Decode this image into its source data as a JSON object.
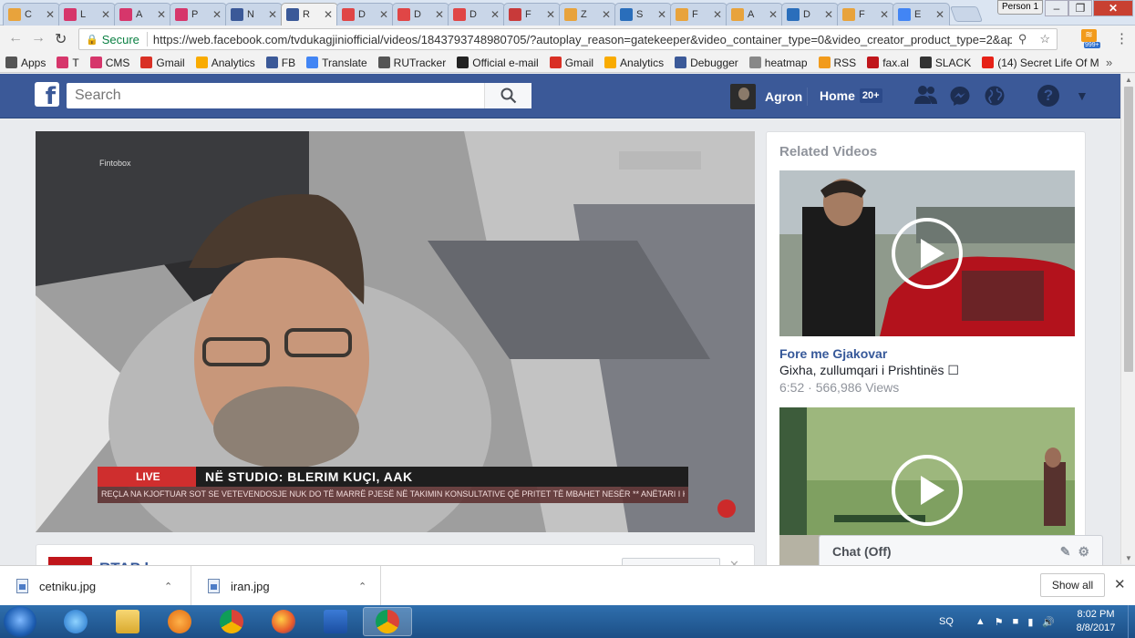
{
  "browser": {
    "tabs": [
      {
        "title": "C",
        "icon": "pen-icon",
        "color": "#e8a33c"
      },
      {
        "title": "L",
        "icon": "z-icon",
        "color": "#d6366b"
      },
      {
        "title": "A",
        "icon": "z-icon",
        "color": "#d6366b"
      },
      {
        "title": "P",
        "icon": "z-icon",
        "color": "#d6366b"
      },
      {
        "title": "N",
        "icon": "facebook-icon",
        "color": "#3b5998"
      },
      {
        "title": "R",
        "icon": "facebook-icon",
        "color": "#3b5998"
      },
      {
        "title": "D",
        "icon": "k-icon",
        "color": "#e04646"
      },
      {
        "title": "D",
        "icon": "k-icon",
        "color": "#e04646"
      },
      {
        "title": "D",
        "icon": "k-icon",
        "color": "#e04646"
      },
      {
        "title": "F",
        "icon": "ge-icon",
        "color": "#c83a3a"
      },
      {
        "title": "Z",
        "icon": "pen-icon",
        "color": "#e8a33c"
      },
      {
        "title": "S",
        "icon": "k-blue-icon",
        "color": "#2a6ebb"
      },
      {
        "title": "F",
        "icon": "pen-icon",
        "color": "#e8a33c"
      },
      {
        "title": "A",
        "icon": "pen-icon",
        "color": "#e8a33c"
      },
      {
        "title": "D",
        "icon": "k-blue-icon",
        "color": "#2a6ebb"
      },
      {
        "title": "F",
        "icon": "pen-icon",
        "color": "#e8a33c"
      },
      {
        "title": "E",
        "icon": "google-icon",
        "color": "#4285f4"
      }
    ],
    "active_tab_index": 5,
    "profile": "Person 1",
    "security_label": "Secure",
    "url": "https://web.facebook.com/tvdukagjiniofficial/videos/1843793748980705/?autoplay_reason=gatekeeper&video_container_type=0&video_creator_product_type=2&app_id...",
    "rss_badge": "999+",
    "bookmarks": [
      {
        "label": "Apps",
        "icon": "apps-grid-icon",
        "color": "#555555"
      },
      {
        "label": "T",
        "icon": "z-icon",
        "color": "#d6366b"
      },
      {
        "label": "CMS",
        "icon": "z-icon",
        "color": "#d6366b"
      },
      {
        "label": "Gmail",
        "icon": "gmail-icon",
        "color": "#d93025"
      },
      {
        "label": "Analytics",
        "icon": "analytics-icon",
        "color": "#f9ab00"
      },
      {
        "label": "FB",
        "icon": "facebook-icon",
        "color": "#3b5998"
      },
      {
        "label": "Translate",
        "icon": "translate-icon",
        "color": "#4285f4"
      },
      {
        "label": "RUTracker",
        "icon": "tracker-icon",
        "color": "#555555"
      },
      {
        "label": "Official e-mail",
        "icon": "shield-icon",
        "color": "#222222"
      },
      {
        "label": "Gmail",
        "icon": "gmail-icon",
        "color": "#d93025"
      },
      {
        "label": "Analytics",
        "icon": "analytics-icon",
        "color": "#f9ab00"
      },
      {
        "label": "Debugger",
        "icon": "facebook-icon",
        "color": "#3b5998"
      },
      {
        "label": "heatmap",
        "icon": "page-icon",
        "color": "#888888"
      },
      {
        "label": "RSS",
        "icon": "rss-icon",
        "color": "#f29b1c"
      },
      {
        "label": "fax.al",
        "icon": "f-icon",
        "color": "#c0161b"
      },
      {
        "label": "SLACK",
        "icon": "hash-icon",
        "color": "#333333"
      },
      {
        "label": "(14) Secret Life Of M",
        "icon": "youtube-icon",
        "color": "#e62117"
      }
    ]
  },
  "facebook": {
    "search_placeholder": "Search",
    "user_name": "Agron",
    "home_label": "Home",
    "home_badge": "20+",
    "brand_color": "#3b5998"
  },
  "video": {
    "lower_third_live": "LIVE",
    "lower_third_title": "NË STUDIO: BLERIM KUÇI, AAK",
    "ticker": "REÇLA NA KJOFTUAR SOT SE VETEVENDOSJE NUK DO TË MARRË PJESË NË TAKIMIN KONSULTATIVE QË PRITET TË MBAHET NESËR   ** ANËTARI I KRYESISË",
    "watermark_left": "Fintobox"
  },
  "post": {
    "page_name": "RTAP k"
  },
  "related": {
    "heading": "Related Videos",
    "items": [
      {
        "title": "Fore me Gjakovar",
        "description": "Gixha, zullumqari i Prishtinës ☐",
        "duration": "6:52",
        "views": "566,986 Views"
      },
      {
        "title": "",
        "description": "",
        "duration": "",
        "views": ""
      }
    ]
  },
  "chat": {
    "label": "Chat (Off)"
  },
  "downloads": {
    "files": [
      "cetniku.jpg",
      "iran.jpg"
    ],
    "show_all": "Show all"
  },
  "taskbar": {
    "apps": [
      "internet-explorer-icon",
      "file-explorer-icon",
      "media-player-icon",
      "chrome-icon",
      "firefox-icon",
      "word-icon",
      "chrome-icon"
    ],
    "active_app_index": 6,
    "language": "SQ",
    "time": "8:02 PM",
    "date": "8/8/2017"
  }
}
